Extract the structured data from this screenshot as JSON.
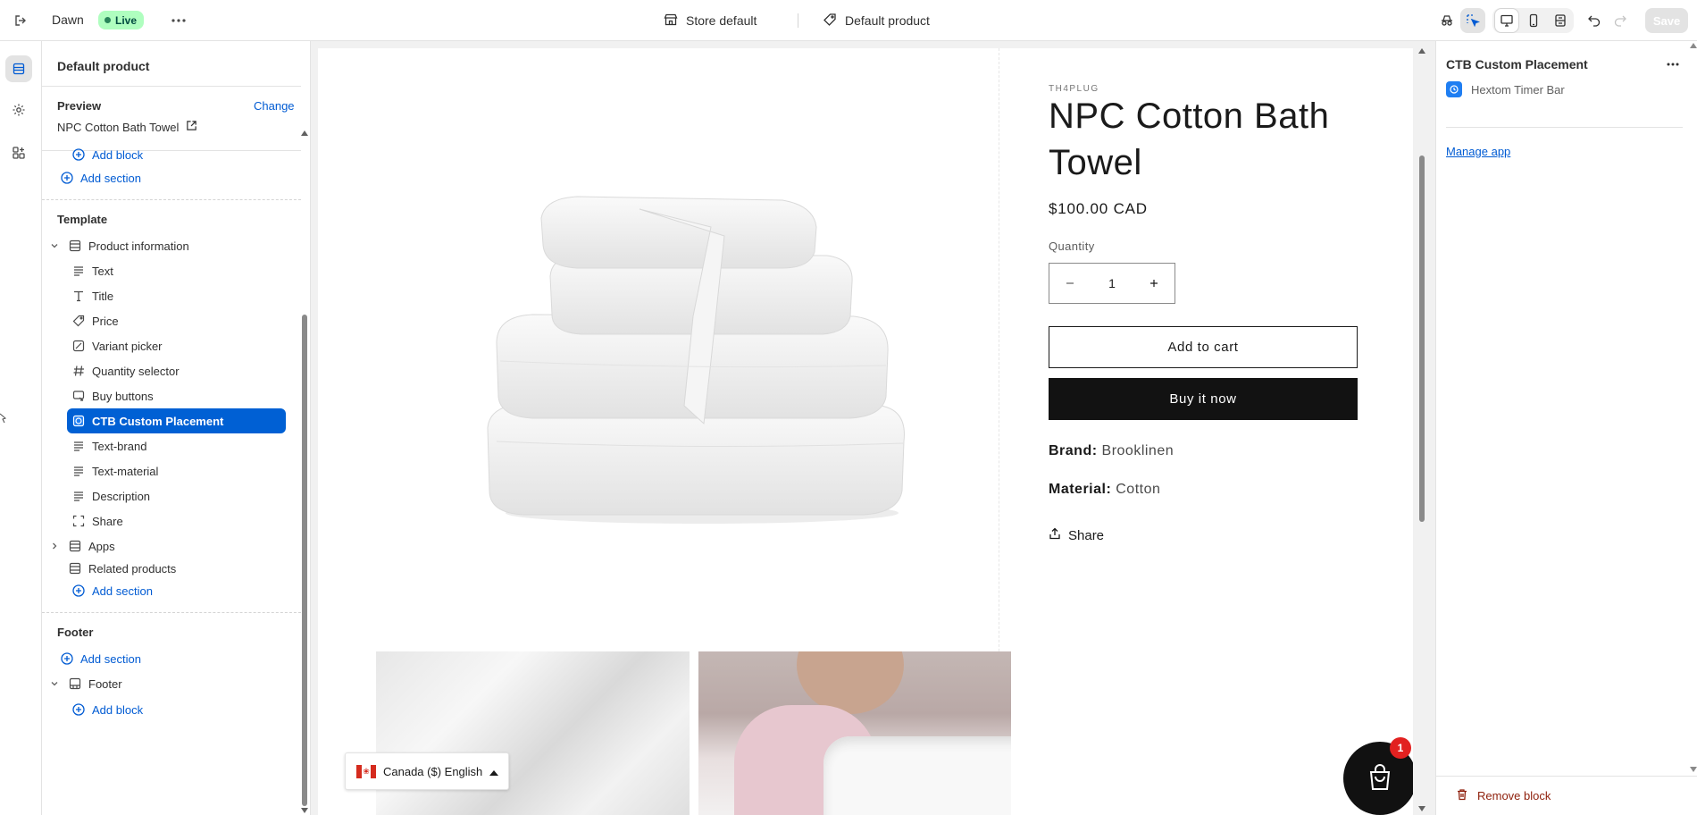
{
  "topbar": {
    "theme_name": "Dawn",
    "status_badge": "Live",
    "store_selector": "Store default",
    "template_selector": "Default product",
    "save_label": "Save"
  },
  "sidebar": {
    "title": "Default product",
    "preview_label": "Preview",
    "change_link": "Change",
    "preview_product": "NPC Cotton Bath Towel",
    "partial_add_block": "Add block",
    "add_section": "Add section",
    "template_heading": "Template",
    "product_info_section": "Product information",
    "blocks": [
      {
        "label": "Text",
        "icon": "text-icon"
      },
      {
        "label": "Title",
        "icon": "title-icon"
      },
      {
        "label": "Price",
        "icon": "price-tag-icon"
      },
      {
        "label": "Variant picker",
        "icon": "variant-icon"
      },
      {
        "label": "Quantity selector",
        "icon": "hash-icon"
      },
      {
        "label": "Buy buttons",
        "icon": "cart-icon"
      },
      {
        "label": "CTB Custom Placement",
        "icon": "app-block-icon"
      },
      {
        "label": "Text-brand",
        "icon": "text-icon"
      },
      {
        "label": "Text-material",
        "icon": "text-icon"
      },
      {
        "label": "Description",
        "icon": "text-icon"
      },
      {
        "label": "Share",
        "icon": "share-frame-icon"
      }
    ],
    "apps_section": "Apps",
    "related_products_section": "Related products",
    "add_section_2": "Add section",
    "footer_heading": "Footer",
    "footer_add_section": "Add section",
    "footer_section": "Footer",
    "footer_add_block": "Add block"
  },
  "product": {
    "vendor": "TH4PLUG",
    "title": "NPC Cotton Bath Towel",
    "price": "$100.00 CAD",
    "quantity_label": "Quantity",
    "quantity_value": "1",
    "add_to_cart": "Add to cart",
    "buy_now": "Buy it now",
    "brand_label": "Brand:",
    "brand_value": "Brooklinen",
    "material_label": "Material:",
    "material_value": "Cotton",
    "share_label": "Share",
    "locale_selector": "Canada ($) English",
    "cart_count": "1"
  },
  "right_panel": {
    "title": "CTB Custom Placement",
    "app_name": "Hextom Timer Bar",
    "manage_app": "Manage app",
    "remove_block": "Remove block"
  },
  "colors": {
    "accent_blue": "#005bd3",
    "selected_row": "#0060d4",
    "live_badge_bg": "#affebf",
    "buy_button": "#121212",
    "remove_red": "#8e1f0b"
  }
}
